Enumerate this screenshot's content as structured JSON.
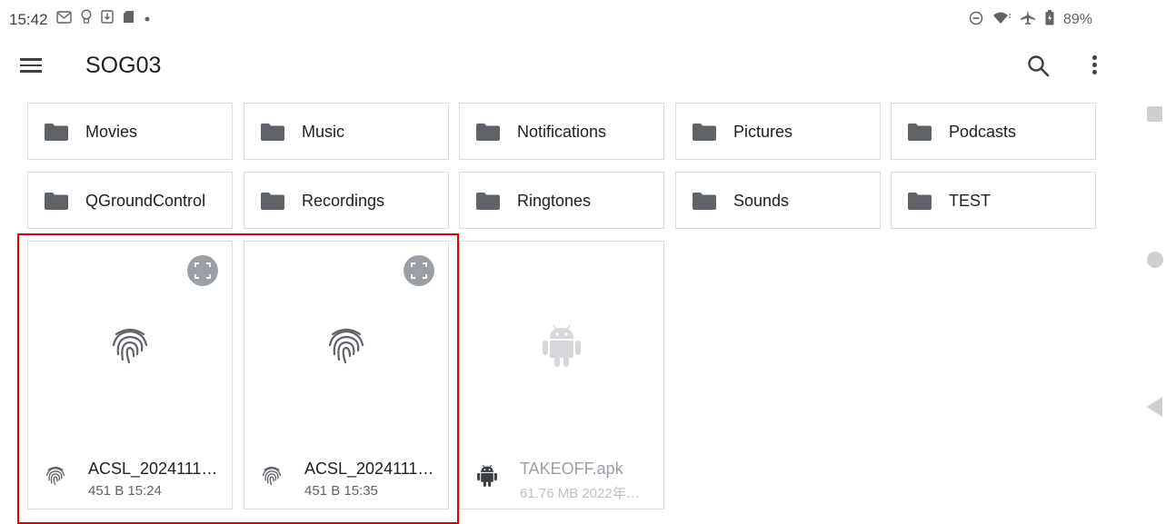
{
  "status_bar": {
    "time": "15:42",
    "battery": "89%",
    "left_icons": [
      "gmail-icon",
      "lightbulb-icon",
      "download-icon",
      "sdcard-icon",
      "dot-icon"
    ],
    "right_icons": [
      "do-not-disturb-icon",
      "wifi-icon",
      "airplane-icon",
      "battery-icon"
    ]
  },
  "app_bar": {
    "title": "SOG03"
  },
  "folders": [
    {
      "label": "Movies"
    },
    {
      "label": "Music"
    },
    {
      "label": "Notifications"
    },
    {
      "label": "Pictures"
    },
    {
      "label": "Podcasts"
    },
    {
      "label": "QGroundControl"
    },
    {
      "label": "Recordings"
    },
    {
      "label": "Ringtones"
    },
    {
      "label": "Sounds"
    },
    {
      "label": "TEST"
    }
  ],
  "files": [
    {
      "name": "ACSL_2024111…",
      "meta": "451 B 15:24",
      "icon": "fingerprint-icon"
    },
    {
      "name": "ACSL_2024111…",
      "meta": "451 B 15:35",
      "icon": "fingerprint-icon"
    },
    {
      "name": "TAKEOFF.apk",
      "meta": "61.76 MB 2022年…",
      "icon": "android-icon"
    }
  ],
  "colors": {
    "selection_border": "#e00000",
    "folder_icon": "#5f6368",
    "card_border": "#dadce0"
  }
}
